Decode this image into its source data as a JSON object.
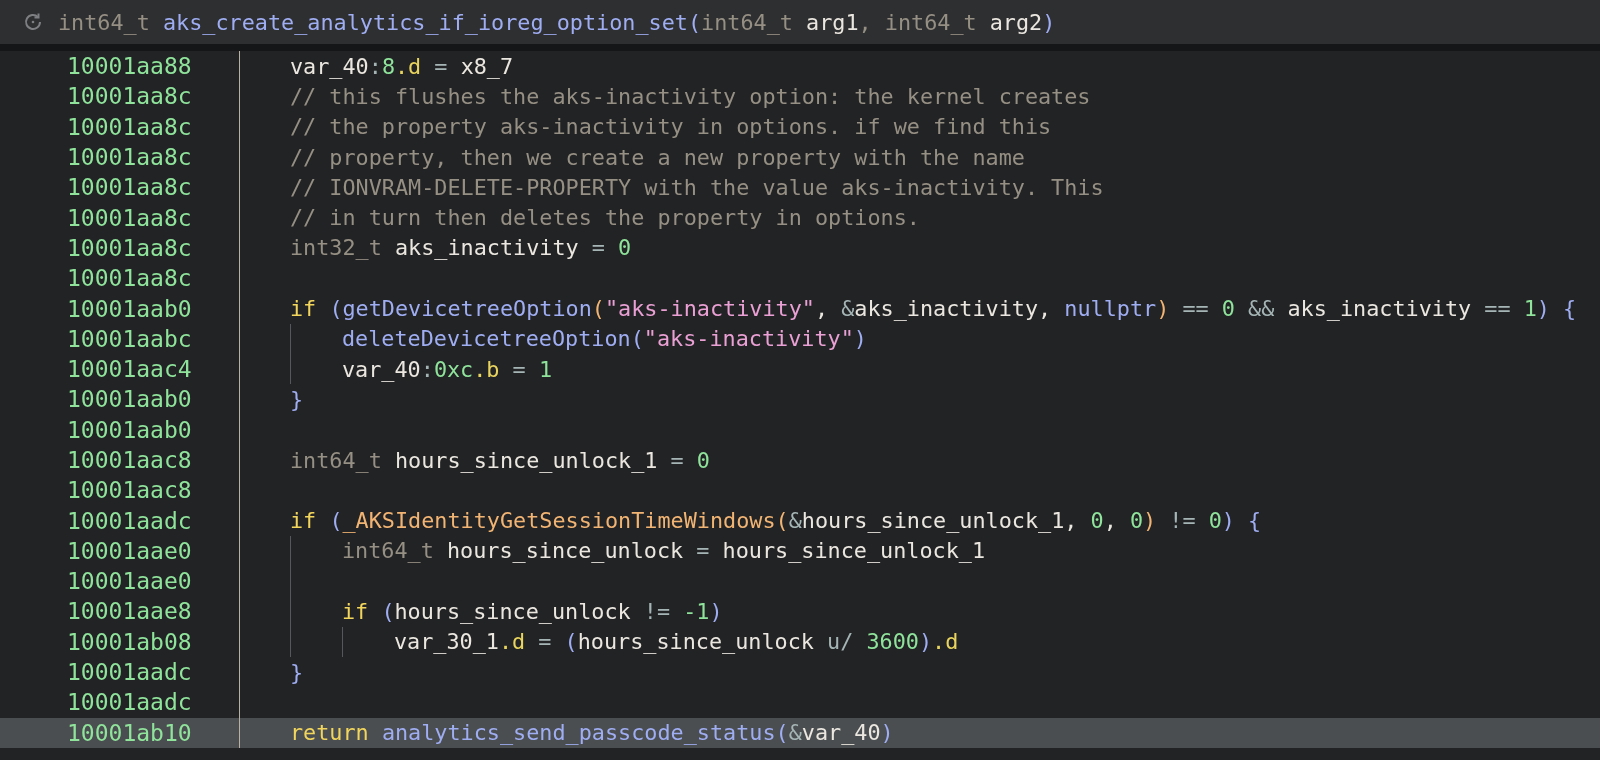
{
  "header": {
    "tokens": [
      {
        "kind": "type",
        "text": "int64_t "
      },
      {
        "kind": "func",
        "text": "aks_create_analytics_if_ioreg_option_set"
      },
      {
        "kind": "func",
        "text": "("
      },
      {
        "kind": "type",
        "text": "int64_t "
      },
      {
        "kind": "plain",
        "text": "arg1"
      },
      {
        "kind": "type",
        "text": ", "
      },
      {
        "kind": "type",
        "text": "int64_t "
      },
      {
        "kind": "plain",
        "text": "arg2"
      },
      {
        "kind": "func",
        "text": ")"
      }
    ]
  },
  "lines": [
    {
      "address": "10001aa88",
      "selected": false,
      "tokens": [
        {
          "kind": "plain",
          "text": "var_40"
        },
        {
          "kind": "op",
          "text": ":"
        },
        {
          "kind": "num",
          "text": "8"
        },
        {
          "kind": "field",
          "text": ".d"
        },
        {
          "kind": "op",
          "text": " = "
        },
        {
          "kind": "plain",
          "text": "x8_7"
        }
      ]
    },
    {
      "address": "10001aa8c",
      "selected": false,
      "tokens": [
        {
          "kind": "comment",
          "text": "// this flushes the aks-inactivity option: the kernel creates"
        }
      ]
    },
    {
      "address": "10001aa8c",
      "selected": false,
      "tokens": [
        {
          "kind": "comment",
          "text": "// the property aks-inactivity in options. if we find this"
        }
      ]
    },
    {
      "address": "10001aa8c",
      "selected": false,
      "tokens": [
        {
          "kind": "comment",
          "text": "// property, then we create a new property with the name"
        }
      ]
    },
    {
      "address": "10001aa8c",
      "selected": false,
      "tokens": [
        {
          "kind": "comment",
          "text": "// IONVRAM-DELETE-PROPERTY with the value aks-inactivity. This"
        }
      ]
    },
    {
      "address": "10001aa8c",
      "selected": false,
      "tokens": [
        {
          "kind": "comment",
          "text": "// in turn then deletes the property in options."
        }
      ]
    },
    {
      "address": "10001aa8c",
      "selected": false,
      "tokens": [
        {
          "kind": "type",
          "text": "int32_t "
        },
        {
          "kind": "plain",
          "text": "aks_inactivity"
        },
        {
          "kind": "op",
          "text": " = "
        },
        {
          "kind": "num",
          "text": "0"
        }
      ]
    },
    {
      "address": "10001aa8c",
      "selected": false
    },
    {
      "address": "10001aab0",
      "selected": false,
      "tokens": [
        {
          "kind": "keyword",
          "text": "if "
        },
        {
          "kind": "func",
          "text": "("
        },
        {
          "kind": "func",
          "text": "getDevicetreeOption"
        },
        {
          "kind": "import",
          "text": "("
        },
        {
          "kind": "string",
          "text": "\"aks-inactivity\""
        },
        {
          "kind": "plain",
          "text": ", "
        },
        {
          "kind": "op",
          "text": "&"
        },
        {
          "kind": "plain",
          "text": "aks_inactivity, "
        },
        {
          "kind": "func",
          "text": "nullptr"
        },
        {
          "kind": "import",
          "text": ")"
        },
        {
          "kind": "op",
          "text": " == "
        },
        {
          "kind": "num",
          "text": "0"
        },
        {
          "kind": "op",
          "text": " && "
        },
        {
          "kind": "plain",
          "text": "aks_inactivity"
        },
        {
          "kind": "op",
          "text": " == "
        },
        {
          "kind": "num",
          "text": "1"
        },
        {
          "kind": "func",
          "text": ")"
        },
        {
          "kind": "func",
          "text": " {"
        }
      ],
      "children": [
        {
          "address": "10001aabc",
          "selected": false,
          "tokens": [
            {
              "kind": "func",
              "text": "deleteDevicetreeOption"
            },
            {
              "kind": "func",
              "text": "("
            },
            {
              "kind": "string",
              "text": "\"aks-inactivity\""
            },
            {
              "kind": "func",
              "text": ")"
            }
          ]
        },
        {
          "address": "10001aac4",
          "selected": false,
          "tokens": [
            {
              "kind": "plain",
              "text": "var_40"
            },
            {
              "kind": "op",
              "text": ":"
            },
            {
              "kind": "num",
              "text": "0xc"
            },
            {
              "kind": "field",
              "text": ".b"
            },
            {
              "kind": "op",
              "text": " = "
            },
            {
              "kind": "num",
              "text": "1"
            }
          ]
        }
      ]
    },
    {
      "address": "10001aab0",
      "selected": false,
      "tokens": [
        {
          "kind": "func",
          "text": "}"
        }
      ]
    },
    {
      "address": "10001aab0",
      "selected": false
    },
    {
      "address": "10001aac8",
      "selected": false,
      "tokens": [
        {
          "kind": "type",
          "text": "int64_t "
        },
        {
          "kind": "plain",
          "text": "hours_since_unlock_1"
        },
        {
          "kind": "op",
          "text": " = "
        },
        {
          "kind": "num",
          "text": "0"
        }
      ]
    },
    {
      "address": "10001aac8",
      "selected": false
    },
    {
      "address": "10001aadc",
      "selected": false,
      "tokens": [
        {
          "kind": "keyword",
          "text": "if "
        },
        {
          "kind": "func",
          "text": "("
        },
        {
          "kind": "import",
          "text": "_AKSIdentityGetSessionTimeWindows"
        },
        {
          "kind": "import",
          "text": "("
        },
        {
          "kind": "op",
          "text": "&"
        },
        {
          "kind": "plain",
          "text": "hours_since_unlock_1, "
        },
        {
          "kind": "num",
          "text": "0"
        },
        {
          "kind": "plain",
          "text": ", "
        },
        {
          "kind": "num",
          "text": "0"
        },
        {
          "kind": "import",
          "text": ")"
        },
        {
          "kind": "op",
          "text": " != "
        },
        {
          "kind": "num",
          "text": "0"
        },
        {
          "kind": "func",
          "text": ")"
        },
        {
          "kind": "func",
          "text": " {"
        }
      ],
      "children": [
        {
          "address": "10001aae0",
          "selected": false,
          "tokens": [
            {
              "kind": "type",
              "text": "int64_t "
            },
            {
              "kind": "plain",
              "text": "hours_since_unlock"
            },
            {
              "kind": "op",
              "text": " = "
            },
            {
              "kind": "plain",
              "text": "hours_since_unlock_1"
            }
          ]
        },
        {
          "address": "10001aae0",
          "selected": false
        },
        {
          "address": "10001aae8",
          "selected": false,
          "tokens": [
            {
              "kind": "keyword",
              "text": "if "
            },
            {
              "kind": "func",
              "text": "("
            },
            {
              "kind": "plain",
              "text": "hours_since_unlock"
            },
            {
              "kind": "op",
              "text": " != "
            },
            {
              "kind": "num",
              "text": "-1"
            },
            {
              "kind": "func",
              "text": ")"
            }
          ],
          "children": [
            {
              "address": "10001ab08",
              "selected": false,
              "tokens": [
                {
                  "kind": "plain",
                  "text": "var_30_1"
                },
                {
                  "kind": "field",
                  "text": ".d"
                },
                {
                  "kind": "op",
                  "text": " = "
                },
                {
                  "kind": "func",
                  "text": "("
                },
                {
                  "kind": "plain",
                  "text": "hours_since_unlock "
                },
                {
                  "kind": "op",
                  "text": "u/ "
                },
                {
                  "kind": "num",
                  "text": "3600"
                },
                {
                  "kind": "func",
                  "text": ")"
                },
                {
                  "kind": "field",
                  "text": ".d"
                }
              ]
            }
          ]
        }
      ]
    },
    {
      "address": "10001aadc",
      "selected": false,
      "tokens": [
        {
          "kind": "func",
          "text": "}"
        }
      ]
    },
    {
      "address": "10001aadc",
      "selected": false
    },
    {
      "address": "10001ab10",
      "selected": true,
      "tokens": [
        {
          "kind": "keyword",
          "text": "return "
        },
        {
          "kind": "func",
          "text": "analytics_send_passcode_status"
        },
        {
          "kind": "func",
          "text": "("
        },
        {
          "kind": "op",
          "text": "&"
        },
        {
          "kind": "plain",
          "text": "var_40"
        },
        {
          "kind": "func",
          "text": ")"
        }
      ]
    }
  ]
}
